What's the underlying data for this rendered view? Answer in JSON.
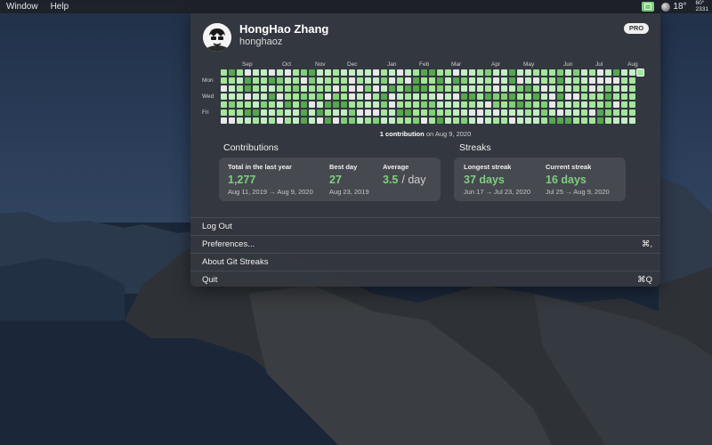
{
  "menubar": {
    "menus": [
      "Window",
      "Help"
    ],
    "tray": {
      "temperature": "18°",
      "mini_top": "60°",
      "mini_bottom": "2331"
    }
  },
  "profile": {
    "name": "HongHao Zhang",
    "username": "honghaoz",
    "badge": "PRO"
  },
  "calendar": {
    "months": [
      "Sep",
      "Oct",
      "Nov",
      "Dec",
      "Jan",
      "Feb",
      "Mar",
      "Apr",
      "May",
      "Jun",
      "Jul",
      "Aug"
    ],
    "day_labels": [
      "Mon",
      "Wed",
      "Fri"
    ],
    "weeks": 53,
    "colors": {
      "empty": "#e8e8e8",
      "l1": "#c2eec2",
      "l2": "#a3e69a",
      "l3": "#7fcf76",
      "l4": "#55a84f",
      "selected": "#9be89b"
    },
    "selected_count": "1 contribution",
    "selected_date": "on Aug 9, 2020"
  },
  "contributions": {
    "title": "Contributions",
    "total": {
      "label": "Total in the last year",
      "value": "1,277",
      "range": "Aug 11, 2019 → Aug 9, 2020"
    },
    "best_day": {
      "label": "Best day",
      "value": "27",
      "date": "Aug 23, 2019"
    },
    "average": {
      "label": "Average",
      "value": "3.5",
      "unit": "/ day"
    }
  },
  "streaks": {
    "title": "Streaks",
    "longest": {
      "label": "Longest streak",
      "value": "37 days",
      "range": "Jun 17 → Jul 23, 2020"
    },
    "current": {
      "label": "Current streak",
      "value": "16 days",
      "range": "Jul 25 → Aug 9, 2020"
    }
  },
  "menu": [
    {
      "label": "Log Out",
      "shortcut": ""
    },
    {
      "label": "Preferences...",
      "shortcut": "⌘,"
    },
    {
      "label": "About Git Streaks",
      "shortcut": ""
    },
    {
      "label": "Quit",
      "shortcut": "⌘Q"
    }
  ]
}
